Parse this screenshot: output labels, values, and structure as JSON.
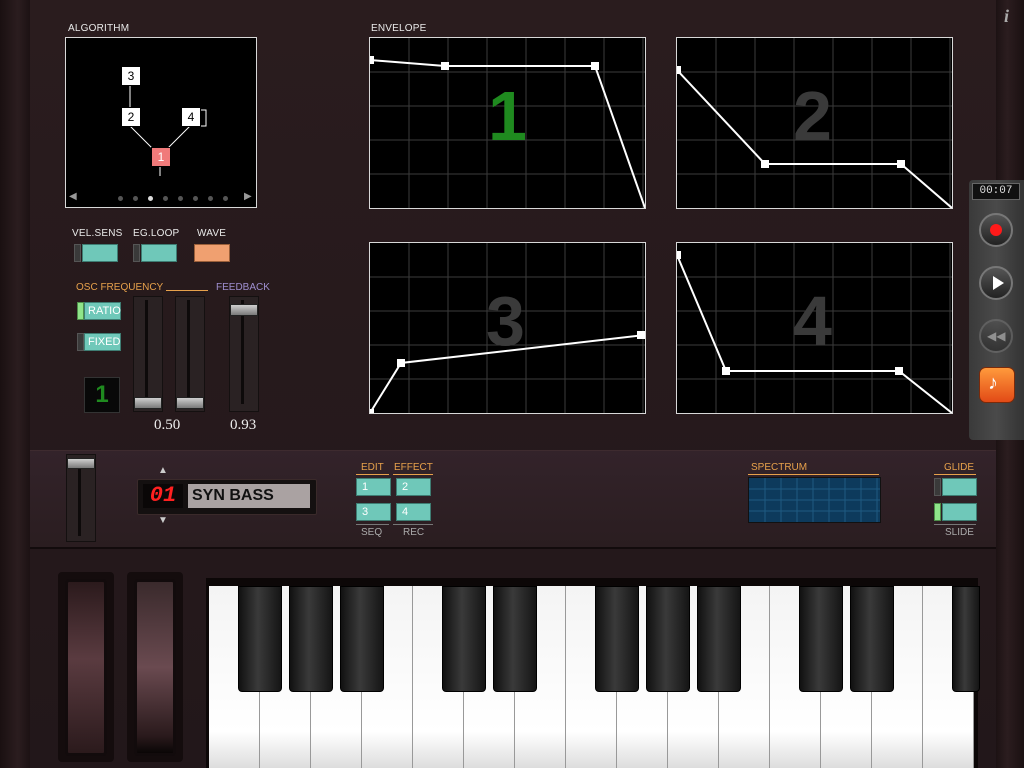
{
  "sections": {
    "algorithm": "ALGORITHM",
    "envelope": "ENVELOPE",
    "vel_sens": "VEL.SENS",
    "eg_loop": "EG.LOOP",
    "wave": "WAVE",
    "osc_frequency": "OSC FREQUENCY",
    "feedback": "FEEDBACK",
    "spectrum": "SPECTRUM",
    "glide": "GLIDE",
    "slide": "SLIDE",
    "edit": "EDIT",
    "effect": "EFFECT",
    "seq": "SEQ",
    "rec": "REC"
  },
  "algorithm": {
    "operators": [
      "3",
      "2",
      "4",
      "1"
    ],
    "page_dots": 8,
    "active_dot": 3
  },
  "osc": {
    "ratio_label": "RATIO",
    "fixed_label": "FIXED",
    "selected_operator": "1",
    "ratio_value": "0.50",
    "feedback_value": "0.93"
  },
  "envelopes": [
    {
      "label": "1",
      "color": "#1f8a1f"
    },
    {
      "label": "2",
      "color": "#3a3a3a"
    },
    {
      "label": "3",
      "color": "#3a3a3a"
    },
    {
      "label": "4",
      "color": "#3a3a3a"
    }
  ],
  "preset": {
    "number": "01",
    "name": "SYN BASS",
    "up_arrow": "▲",
    "down_arrow": "▼"
  },
  "edit_buttons": [
    "1",
    "2",
    "3",
    "4"
  ],
  "transport": {
    "time": "00:07"
  },
  "info_icon": "i",
  "colors": {
    "accent_teal": "#6fc8b9",
    "wave_orange": "#f0a070",
    "record_red": "#ff1a1a",
    "led_green": "#1f8a1f",
    "op_highlight": "#f07a7a"
  }
}
